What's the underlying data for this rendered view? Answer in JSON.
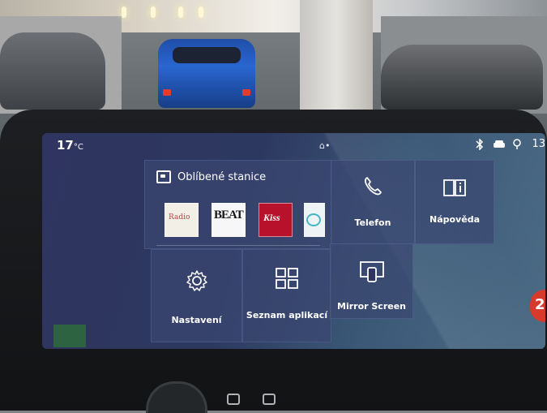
{
  "status_bar": {
    "temperature": "17",
    "temperature_unit": "°C",
    "home_indicator": "⌂•",
    "right_text": "13",
    "icons": [
      "bluetooth-icon",
      "car-icon",
      "location-pin-icon"
    ]
  },
  "favorites_tile": {
    "title": "Oblíbené stanice",
    "icon": "radio-icon",
    "stations": [
      {
        "id": "station-1",
        "label": "Radio"
      },
      {
        "id": "station-2",
        "label": "BEAT"
      },
      {
        "id": "station-3",
        "label": "Kiss"
      },
      {
        "id": "station-4",
        "label": ""
      }
    ]
  },
  "tiles": {
    "telefon": {
      "label": "Telefon",
      "icon": "phone-icon"
    },
    "napoveda": {
      "label": "Nápověda",
      "icon": "book-info-icon"
    },
    "nastaveni": {
      "label": "Nastavení",
      "icon": "gear-icon"
    },
    "seznam": {
      "label": "Seznam aplikací",
      "icon": "grid-icon"
    },
    "mirror": {
      "label": "Mirror Screen",
      "icon": "mirror-screen-icon"
    }
  },
  "notification_badge": "2",
  "colors": {
    "screen_bg": "#2f3560",
    "tile_bg": "#3a4670",
    "badge_red": "#d63a2a"
  }
}
